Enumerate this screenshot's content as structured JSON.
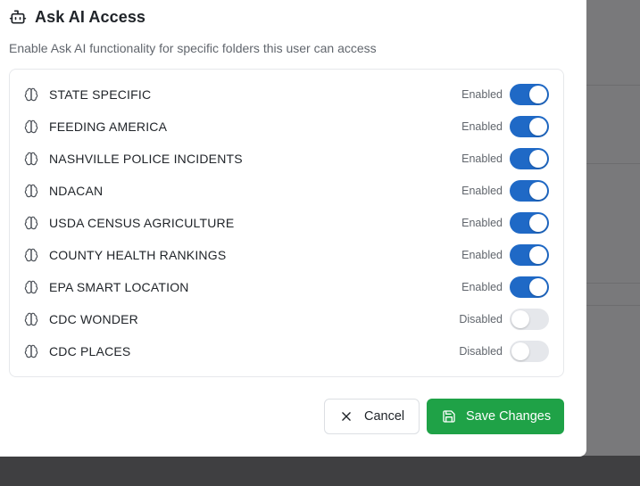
{
  "dialog": {
    "title": "Ask AI Access",
    "subtitle": "Enable Ask AI functionality for specific folders this user can access",
    "header_icon": "bot-icon"
  },
  "folders": [
    {
      "name": "STATE SPECIFIC",
      "status": "Enabled",
      "enabled": true
    },
    {
      "name": "FEEDING AMERICA",
      "status": "Enabled",
      "enabled": true
    },
    {
      "name": "NASHVILLE POLICE INCIDENTS",
      "status": "Enabled",
      "enabled": true
    },
    {
      "name": "NDACAN",
      "status": "Enabled",
      "enabled": true
    },
    {
      "name": "USDA CENSUS AGRICULTURE",
      "status": "Enabled",
      "enabled": true
    },
    {
      "name": "COUNTY HEALTH RANKINGS",
      "status": "Enabled",
      "enabled": true
    },
    {
      "name": "EPA SMART LOCATION",
      "status": "Enabled",
      "enabled": true
    },
    {
      "name": "CDC WONDER",
      "status": "Disabled",
      "enabled": false
    },
    {
      "name": "CDC PLACES",
      "status": "Disabled",
      "enabled": false
    }
  ],
  "actions": {
    "cancel_label": "Cancel",
    "save_label": "Save Changes"
  },
  "colors": {
    "toggle_on": "#1f69c6",
    "toggle_off": "#e5e7eb",
    "save_button": "#1fa247"
  }
}
